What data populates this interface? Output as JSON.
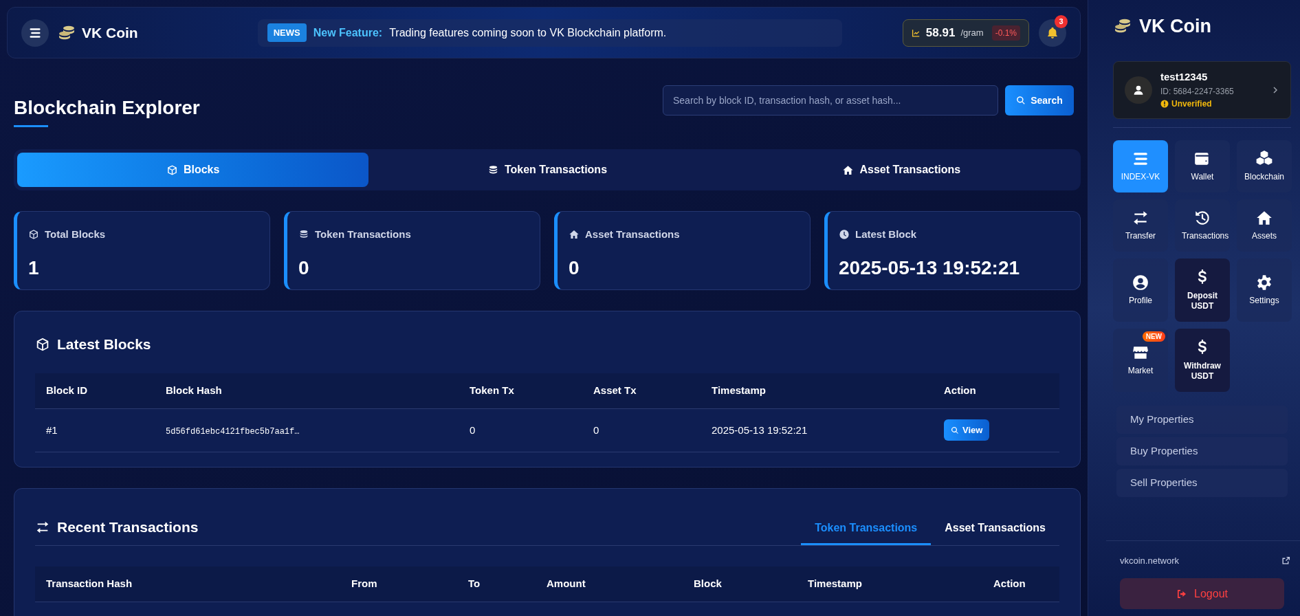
{
  "header": {
    "logo_text": "VK Coin",
    "news_badge": "NEWS",
    "news_label": "New Feature:",
    "news_text": "Trading features coming soon to VK Blockchain platform.",
    "price": "58.91",
    "price_unit": "/gram",
    "price_change": "-0.1%",
    "notification_count": "3"
  },
  "page_title": "Blockchain Explorer",
  "search": {
    "placeholder": "Search by block ID, transaction hash, or asset hash...",
    "button": "Search"
  },
  "tabs": [
    {
      "label": "Blocks",
      "selected": true
    },
    {
      "label": "Token Transactions",
      "selected": false
    },
    {
      "label": "Asset Transactions",
      "selected": false
    }
  ],
  "stats": [
    {
      "label": "Total Blocks",
      "value": "1"
    },
    {
      "label": "Token Transactions",
      "value": "0"
    },
    {
      "label": "Asset Transactions",
      "value": "0"
    },
    {
      "label": "Latest Block",
      "value": "2025-05-13 19:52:21"
    }
  ],
  "latest_blocks": {
    "title": "Latest Blocks",
    "columns": [
      "Block ID",
      "Block Hash",
      "Token Tx",
      "Asset Tx",
      "Timestamp",
      "Action"
    ],
    "rows": [
      {
        "block_id": "#1",
        "hash": "5d56fd61ebc4121fbec5b7aa1f…",
        "token_tx": "0",
        "asset_tx": "0",
        "timestamp": "2025-05-13 19:52:21",
        "action": "View"
      }
    ]
  },
  "recent_transactions": {
    "title": "Recent Transactions",
    "tabs": [
      {
        "label": "Token Transactions",
        "selected": true
      },
      {
        "label": "Asset Transactions",
        "selected": false
      }
    ],
    "columns": [
      "Transaction Hash",
      "From",
      "To",
      "Amount",
      "Block",
      "Timestamp",
      "Action"
    ]
  },
  "sidebar": {
    "logo_text": "VK Coin",
    "user": {
      "name": "test12345",
      "id": "ID: 5684-2247-3365",
      "status": "Unverified"
    },
    "tiles": [
      {
        "label": "INDEX-VK",
        "kind": "nav",
        "selected": true
      },
      {
        "label": "Wallet",
        "kind": "nav",
        "selected": false
      },
      {
        "label": "Blockchain",
        "kind": "nav",
        "selected": false
      },
      {
        "label": "Transfer",
        "kind": "nav",
        "selected": false
      },
      {
        "label": "Transactions",
        "kind": "nav",
        "selected": false
      },
      {
        "label": "Assets",
        "kind": "nav",
        "selected": false
      },
      {
        "label": "Profile",
        "kind": "nav",
        "selected": false
      },
      {
        "label": "Deposit USDT",
        "kind": "usdt",
        "selected": false
      },
      {
        "label": "Settings",
        "kind": "nav",
        "selected": false
      },
      {
        "label": "Market",
        "kind": "nav",
        "selected": false,
        "badge": "NEW"
      },
      {
        "label": "Withdraw USDT",
        "kind": "usdt",
        "selected": false
      }
    ],
    "properties": [
      "My Properties",
      "Buy Properties",
      "Sell Properties"
    ],
    "footer_link": "vkcoin.network",
    "logout": "Logout"
  }
}
